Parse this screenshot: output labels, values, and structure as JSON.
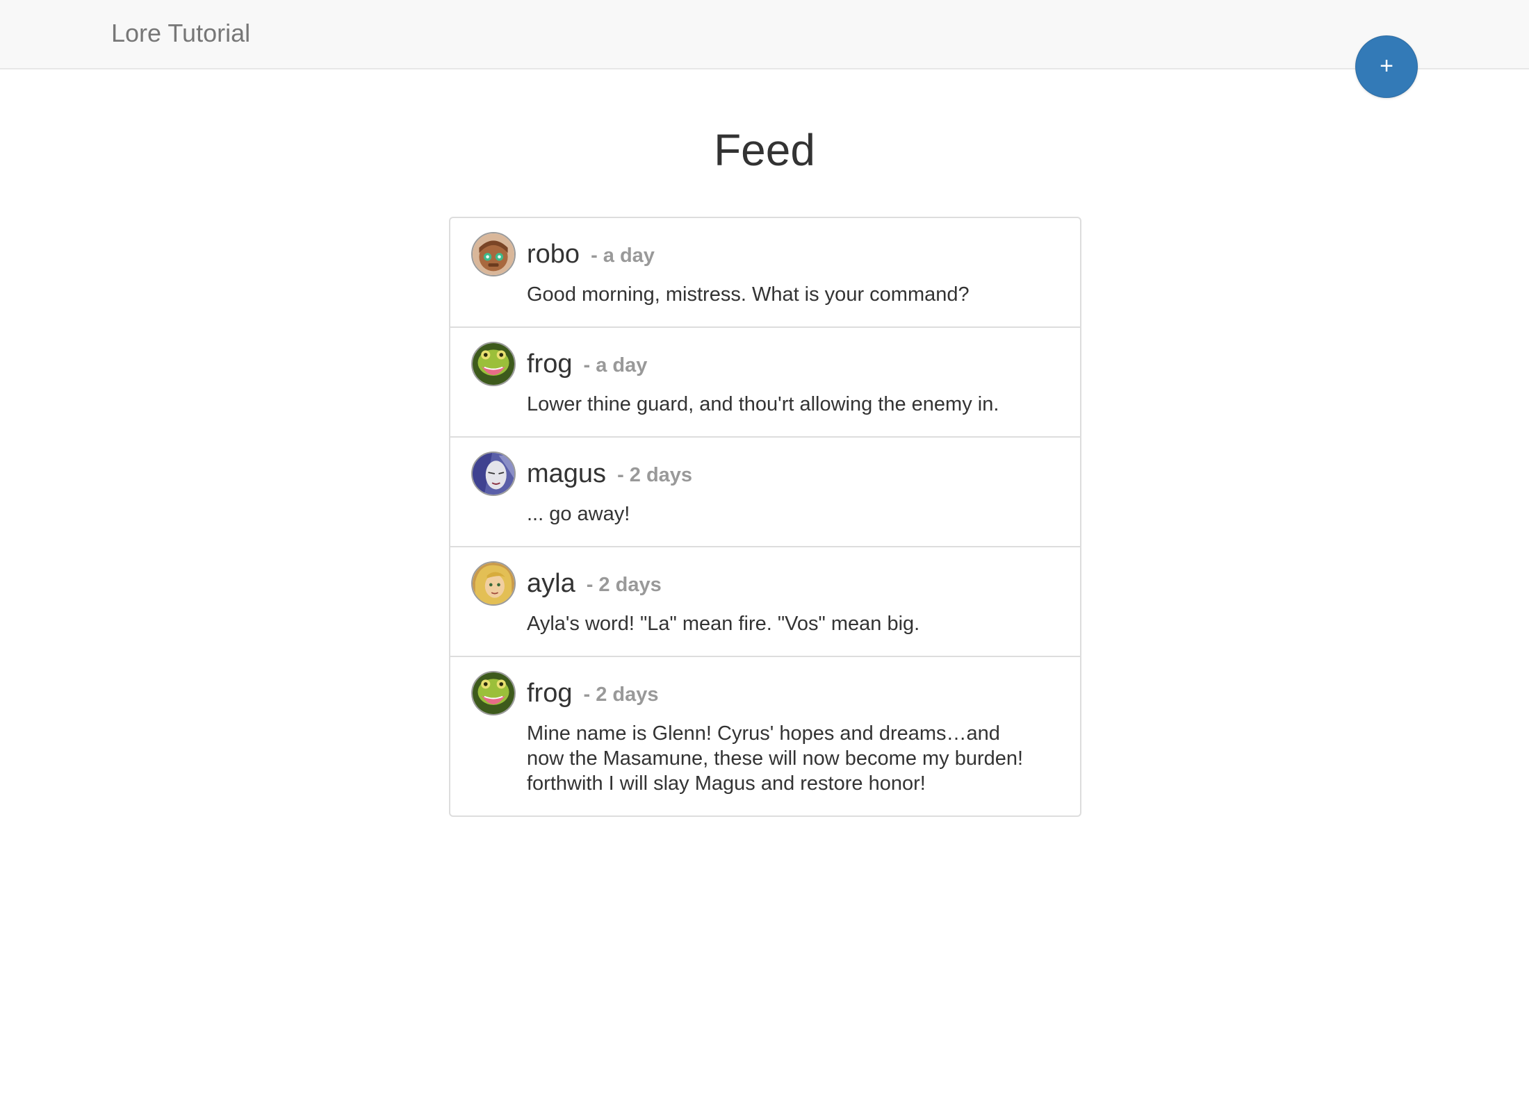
{
  "navbar": {
    "brand": "Lore Tutorial",
    "add_button_label": "+"
  },
  "page": {
    "title": "Feed"
  },
  "feed": [
    {
      "avatar_icon": "robo-avatar-icon",
      "username": "robo",
      "timestamp": "- a day",
      "text": "Good morning, mistress. What is your command?"
    },
    {
      "avatar_icon": "frog-avatar-icon",
      "username": "frog",
      "timestamp": "- a day",
      "text": "Lower thine guard, and thou'rt allowing the enemy in."
    },
    {
      "avatar_icon": "magus-avatar-icon",
      "username": "magus",
      "timestamp": "- 2 days",
      "text": "... go away!"
    },
    {
      "avatar_icon": "ayla-avatar-icon",
      "username": "ayla",
      "timestamp": "- 2 days",
      "text": "Ayla's word! \"La\" mean fire. \"Vos\" mean big."
    },
    {
      "avatar_icon": "frog-avatar-icon",
      "username": "frog",
      "timestamp": "- 2 days",
      "text": "Mine name is Glenn! Cyrus' hopes and dreams…and now the Masamune, these will now become my burden! forthwith I will slay Magus and restore honor!"
    }
  ],
  "colors": {
    "accent": "#337ab7",
    "navbar_bg": "#f8f8f8",
    "border": "#dddddd",
    "muted_text": "#999999"
  }
}
